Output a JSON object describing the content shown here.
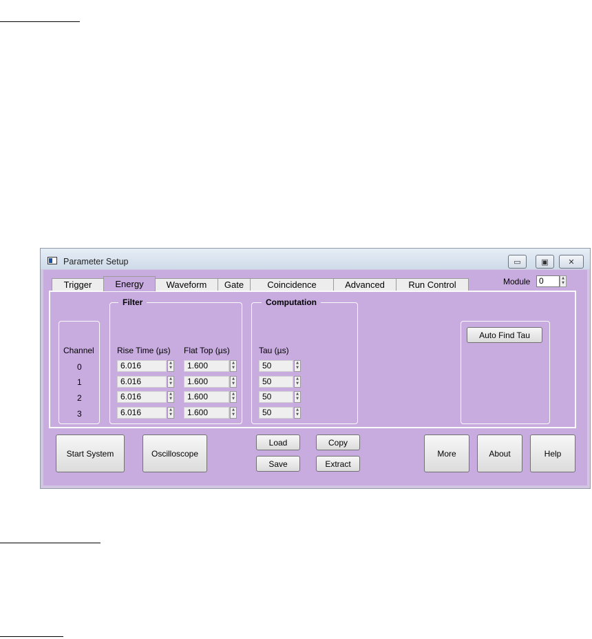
{
  "window": {
    "title": "Parameter Setup",
    "controls": {
      "minimize": "▭",
      "maximize": "▣",
      "close": "✕"
    }
  },
  "tabs": [
    "Trigger",
    "Energy",
    "Waveform",
    "Gate",
    "Coincidence",
    "Advanced",
    "Run Control"
  ],
  "active_tab": "Energy",
  "module": {
    "label": "Module",
    "value": "0"
  },
  "groups": {
    "filter_title": "Filter",
    "computation_title": "Computation"
  },
  "columns": {
    "channel": "Channel",
    "rise_time": "Rise Time (µs)",
    "flat_top": "Flat Top (µs)",
    "tau": "Tau (µs)"
  },
  "rows": [
    {
      "channel": "0",
      "rise_time": "6.016",
      "flat_top": "1.600",
      "tau": "50"
    },
    {
      "channel": "1",
      "rise_time": "6.016",
      "flat_top": "1.600",
      "tau": "50"
    },
    {
      "channel": "2",
      "rise_time": "6.016",
      "flat_top": "1.600",
      "tau": "50"
    },
    {
      "channel": "3",
      "rise_time": "6.016",
      "flat_top": "1.600",
      "tau": "50"
    }
  ],
  "buttons": {
    "auto_find_tau": "Auto Find Tau",
    "start_system": "Start System",
    "oscilloscope": "Oscilloscope",
    "load": "Load",
    "save": "Save",
    "copy": "Copy",
    "extract": "Extract",
    "more": "More",
    "about": "About",
    "help": "Help"
  },
  "icons": {
    "spinner": "spin-updown-icon",
    "app": "window-app-icon"
  },
  "colors": {
    "client_bg": "#c8abdf",
    "frame_bg": "#d3c6e3",
    "titlebar": "#dbe4ef"
  }
}
